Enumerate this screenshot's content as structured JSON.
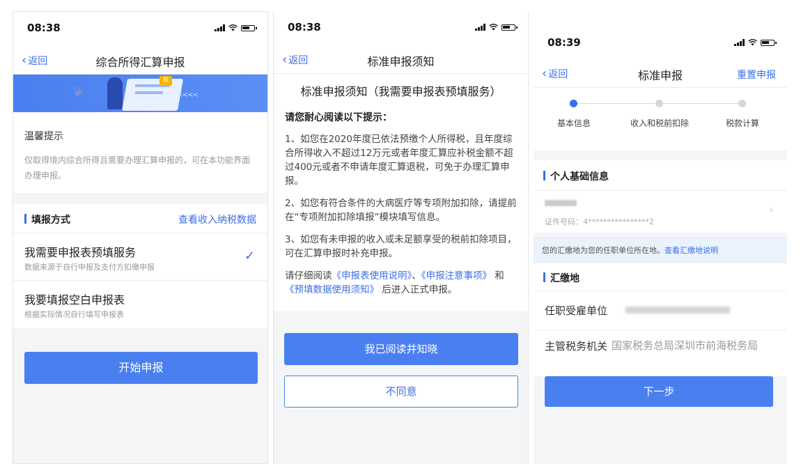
{
  "phone1": {
    "time": "08:38",
    "back": "返回",
    "title": "综合所得汇算申报",
    "banner_tag": "税",
    "banner_arrows": "<<<<",
    "tips_title": "温馨提示",
    "tips_body": "仅取得境内综合所得且需要办理汇算申报的，可在本功能界面办理申报。",
    "section_label": "填报方式",
    "section_link": "查看收入纳税数据",
    "options": [
      {
        "title": "我需要申报表预填服务",
        "subtitle": "数据来源于自行申报及支付方扣缴申报",
        "selected": true
      },
      {
        "title": "我要填报空白申报表",
        "subtitle": "根据实际情况自行填写申报表",
        "selected": false
      }
    ],
    "start_button": "开始申报"
  },
  "phone2": {
    "time": "08:38",
    "back": "返回",
    "title": "标准申报须知",
    "heading": "标准申报须知（我需要申报表预填服务）",
    "subheading": "请您耐心阅读以下提示：",
    "p1": "1、如您在2020年度已依法预缴个人所得税，且年度综合所得收入不超过12万元或者年度汇算应补税金额不超过400元或者不申请年度汇算退税，可免于办理汇算申报。",
    "p2": "2、如您有符合条件的大病医疗等专项附加扣除，请提前在“专项附加扣除填报”模块填写信息。",
    "p3": "3、如您有未申报的收入或未足额享受的税前扣除项目，可在汇算申报时补充申报。",
    "p4_prefix": "请仔细阅读",
    "p4_link1": "《申报表使用说明》",
    "p4_sep1": "、",
    "p4_link2": "《申报注意事项》",
    "p4_sep2": "和",
    "p4_link3": "《预填数据使用须知》",
    "p4_suffix": "后进入正式申报。",
    "read_button": "我已阅读并知晓",
    "disagree_button": "不同意"
  },
  "phone3": {
    "time": "08:39",
    "back": "返回",
    "title": "标准申报",
    "reset": "重置申报",
    "steps": [
      "基本信息",
      "收入和税前扣除",
      "税款计算"
    ],
    "active_step": 0,
    "personal_section": "个人基础信息",
    "id_text": "证件号码：4****************2",
    "info_text": "您的汇缴地为您的任职单位所在地。",
    "info_link": "查看汇缴地说明",
    "remit_section": "汇缴地",
    "employer_label": "任职受雇单位",
    "authority_label": "主管税务机关",
    "authority_value": "国家税务总局深圳市前海税务局",
    "next_button": "下一步"
  },
  "colors": {
    "accent": "#3b6fe8",
    "button": "#4a7ff0",
    "info_bg": "#eaf2fc"
  }
}
